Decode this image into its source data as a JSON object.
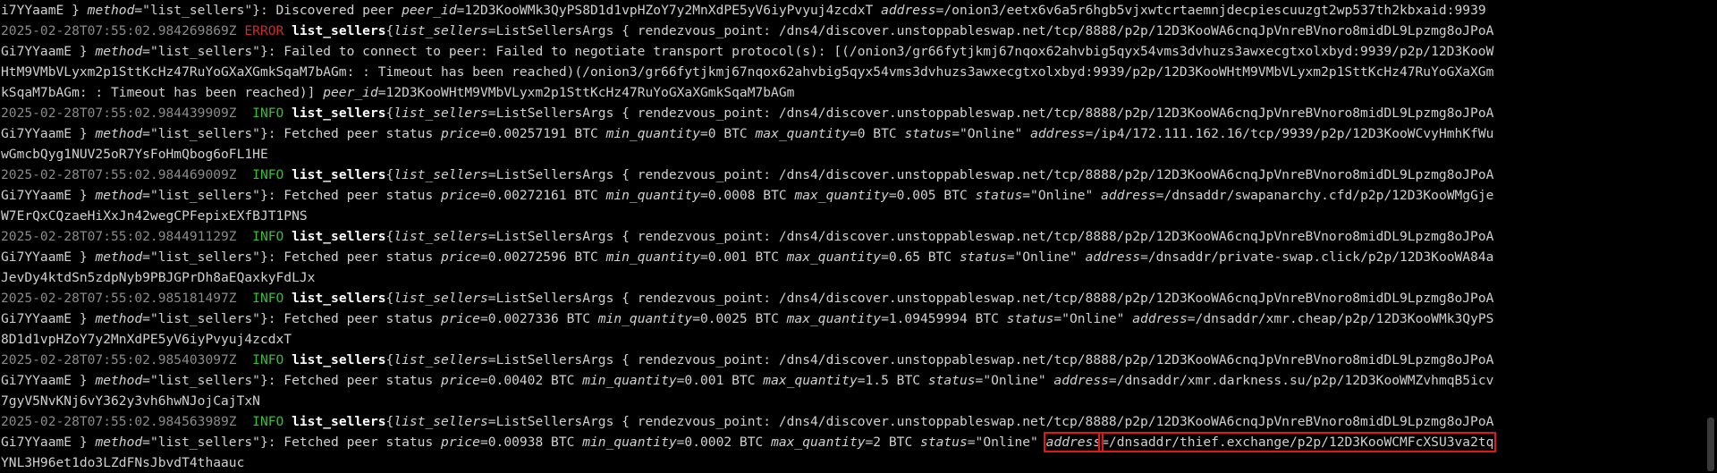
{
  "terminal": {
    "highlight_color": "#e01818",
    "level_colors": {
      "ERROR": "#cd2b2b",
      "INFO": "#3fb83f"
    },
    "lines": [
      {
        "segments": [
          {
            "t": "i7YYaamE } "
          },
          {
            "t": "method",
            "c": "key"
          },
          {
            "t": "=\"list_sellers\"}: Discovered peer "
          },
          {
            "t": "peer_id",
            "c": "key"
          },
          {
            "t": "=12D3KooWMk3QyPS8D1d1vpHZoY7y2MnXdPE5yV6iyPvyuj4zcdxT "
          },
          {
            "t": "address",
            "c": "key"
          },
          {
            "t": "=/onion3/eetx6v6a5r6hgb5vjxwtcrtaemnjdecpiescuuzgt2wp537th2kbxaid:9939"
          }
        ]
      },
      {
        "segments": [
          {
            "t": "2025-02-28T07:55:02.984269869Z ",
            "c": "ts"
          },
          {
            "t": "ERROR",
            "c": "lvl-ERROR"
          },
          {
            "t": " "
          },
          {
            "t": "list_sellers",
            "c": "span-name"
          },
          {
            "t": "{"
          },
          {
            "t": "list_sellers",
            "c": "key"
          },
          {
            "t": "=ListSellersArgs { rendezvous_point: /dns4/discover.unstoppableswap.net/tcp/8888/p2p/12D3KooWA6cnqJpVnreBVnoro8midDL9Lpzmg8oJPoA"
          }
        ]
      },
      {
        "segments": [
          {
            "t": "Gi7YYaamE } "
          },
          {
            "t": "method",
            "c": "key"
          },
          {
            "t": "=\"list_sellers\"}: Failed to connect to peer: Failed to negotiate transport protocol(s): [(/onion3/gr66fytjkmj67nqox62ahvbig5qyx54vms3dvhuzs3awxecgtxolxbyd:9939/p2p/12D3KooW"
          }
        ]
      },
      {
        "segments": [
          {
            "t": "HtM9VMbVLyxm2p1SttKcHz47RuYoGXaXGmkSqaM7bAGm: : Timeout has been reached)(/onion3/gr66fytjkmj67nqox62ahvbig5qyx54vms3dvhuzs3awxecgtxolxbyd:9939/p2p/12D3KooWHtM9VMbVLyxm2p1SttKcHz47RuYoGXaXGm"
          }
        ]
      },
      {
        "segments": [
          {
            "t": "kSqaM7bAGm: : Timeout has been reached)] "
          },
          {
            "t": "peer_id",
            "c": "key"
          },
          {
            "t": "=12D3KooWHtM9VMbVLyxm2p1SttKcHz47RuYoGXaXGmkSqaM7bAGm"
          }
        ]
      },
      {
        "segments": [
          {
            "t": "2025-02-28T07:55:02.984439909Z ",
            "c": "ts"
          },
          {
            "t": " INFO",
            "c": "lvl-INFO"
          },
          {
            "t": " "
          },
          {
            "t": "list_sellers",
            "c": "span-name"
          },
          {
            "t": "{"
          },
          {
            "t": "list_sellers",
            "c": "key"
          },
          {
            "t": "=ListSellersArgs { rendezvous_point: /dns4/discover.unstoppableswap.net/tcp/8888/p2p/12D3KooWA6cnqJpVnreBVnoro8midDL9Lpzmg8oJPoA"
          }
        ]
      },
      {
        "segments": [
          {
            "t": "Gi7YYaamE } "
          },
          {
            "t": "method",
            "c": "key"
          },
          {
            "t": "=\"list_sellers\"}: Fetched peer status "
          },
          {
            "t": "price",
            "c": "key"
          },
          {
            "t": "=0.00257191 BTC "
          },
          {
            "t": "min_quantity",
            "c": "key"
          },
          {
            "t": "=0 BTC "
          },
          {
            "t": "max_quantity",
            "c": "key"
          },
          {
            "t": "=0 BTC "
          },
          {
            "t": "status",
            "c": "key"
          },
          {
            "t": "=\"Online\" "
          },
          {
            "t": "address",
            "c": "key"
          },
          {
            "t": "=/ip4/172.111.162.16/tcp/9939/p2p/12D3KooWCvyHmhKfWu"
          }
        ]
      },
      {
        "segments": [
          {
            "t": "wGmcbQyg1NUV25oR7YsFoHmQbog6oFL1HE"
          }
        ]
      },
      {
        "segments": [
          {
            "t": "2025-02-28T07:55:02.984469009Z ",
            "c": "ts"
          },
          {
            "t": " INFO",
            "c": "lvl-INFO"
          },
          {
            "t": " "
          },
          {
            "t": "list_sellers",
            "c": "span-name"
          },
          {
            "t": "{"
          },
          {
            "t": "list_sellers",
            "c": "key"
          },
          {
            "t": "=ListSellersArgs { rendezvous_point: /dns4/discover.unstoppableswap.net/tcp/8888/p2p/12D3KooWA6cnqJpVnreBVnoro8midDL9Lpzmg8oJPoA"
          }
        ]
      },
      {
        "segments": [
          {
            "t": "Gi7YYaamE } "
          },
          {
            "t": "method",
            "c": "key"
          },
          {
            "t": "=\"list_sellers\"}: Fetched peer status "
          },
          {
            "t": "price",
            "c": "key"
          },
          {
            "t": "=0.00272161 BTC "
          },
          {
            "t": "min_quantity",
            "c": "key"
          },
          {
            "t": "=0.0008 BTC "
          },
          {
            "t": "max_quantity",
            "c": "key"
          },
          {
            "t": "=0.005 BTC "
          },
          {
            "t": "status",
            "c": "key"
          },
          {
            "t": "=\"Online\" "
          },
          {
            "t": "address",
            "c": "key"
          },
          {
            "t": "=/dnsaddr/swapanarchy.cfd/p2p/12D3KooWMgGje"
          }
        ]
      },
      {
        "segments": [
          {
            "t": "W7ErQxCQzaeHiXxJn42wegCPFepixEXfBJT1PNS"
          }
        ]
      },
      {
        "segments": [
          {
            "t": "2025-02-28T07:55:02.984491129Z ",
            "c": "ts"
          },
          {
            "t": " INFO",
            "c": "lvl-INFO"
          },
          {
            "t": " "
          },
          {
            "t": "list_sellers",
            "c": "span-name"
          },
          {
            "t": "{"
          },
          {
            "t": "list_sellers",
            "c": "key"
          },
          {
            "t": "=ListSellersArgs { rendezvous_point: /dns4/discover.unstoppableswap.net/tcp/8888/p2p/12D3KooWA6cnqJpVnreBVnoro8midDL9Lpzmg8oJPoA"
          }
        ]
      },
      {
        "segments": [
          {
            "t": "Gi7YYaamE } "
          },
          {
            "t": "method",
            "c": "key"
          },
          {
            "t": "=\"list_sellers\"}: Fetched peer status "
          },
          {
            "t": "price",
            "c": "key"
          },
          {
            "t": "=0.00272596 BTC "
          },
          {
            "t": "min_quantity",
            "c": "key"
          },
          {
            "t": "=0.001 BTC "
          },
          {
            "t": "max_quantity",
            "c": "key"
          },
          {
            "t": "=0.65 BTC "
          },
          {
            "t": "status",
            "c": "key"
          },
          {
            "t": "=\"Online\" "
          },
          {
            "t": "address",
            "c": "key"
          },
          {
            "t": "=/dnsaddr/private-swap.click/p2p/12D3KooWA84a"
          }
        ]
      },
      {
        "segments": [
          {
            "t": "JevDy4ktdSn5zdpNyb9PBJGPrDh8aEQaxkyFdLJx"
          }
        ]
      },
      {
        "segments": [
          {
            "t": "2025-02-28T07:55:02.985181497Z ",
            "c": "ts"
          },
          {
            "t": " INFO",
            "c": "lvl-INFO"
          },
          {
            "t": " "
          },
          {
            "t": "list_sellers",
            "c": "span-name"
          },
          {
            "t": "{"
          },
          {
            "t": "list_sellers",
            "c": "key"
          },
          {
            "t": "=ListSellersArgs { rendezvous_point: /dns4/discover.unstoppableswap.net/tcp/8888/p2p/12D3KooWA6cnqJpVnreBVnoro8midDL9Lpzmg8oJPoA"
          }
        ]
      },
      {
        "segments": [
          {
            "t": "Gi7YYaamE } "
          },
          {
            "t": "method",
            "c": "key"
          },
          {
            "t": "=\"list_sellers\"}: Fetched peer status "
          },
          {
            "t": "price",
            "c": "key"
          },
          {
            "t": "=0.0027336 BTC "
          },
          {
            "t": "min_quantity",
            "c": "key"
          },
          {
            "t": "=0.0025 BTC "
          },
          {
            "t": "max_quantity",
            "c": "key"
          },
          {
            "t": "=1.09459994 BTC "
          },
          {
            "t": "status",
            "c": "key"
          },
          {
            "t": "=\"Online\" "
          },
          {
            "t": "address",
            "c": "key"
          },
          {
            "t": "=/dnsaddr/xmr.cheap/p2p/12D3KooWMk3QyPS"
          }
        ]
      },
      {
        "segments": [
          {
            "t": "8D1d1vpHZoY7y2MnXdPE5yV6iyPvyuj4zcdxT"
          }
        ]
      },
      {
        "segments": [
          {
            "t": "2025-02-28T07:55:02.985403097Z ",
            "c": "ts"
          },
          {
            "t": " INFO",
            "c": "lvl-INFO"
          },
          {
            "t": " "
          },
          {
            "t": "list_sellers",
            "c": "span-name"
          },
          {
            "t": "{"
          },
          {
            "t": "list_sellers",
            "c": "key"
          },
          {
            "t": "=ListSellersArgs { rendezvous_point: /dns4/discover.unstoppableswap.net/tcp/8888/p2p/12D3KooWA6cnqJpVnreBVnoro8midDL9Lpzmg8oJPoA"
          }
        ]
      },
      {
        "segments": [
          {
            "t": "Gi7YYaamE } "
          },
          {
            "t": "method",
            "c": "key"
          },
          {
            "t": "=\"list_sellers\"}: Fetched peer status "
          },
          {
            "t": "price",
            "c": "key"
          },
          {
            "t": "=0.00402 BTC "
          },
          {
            "t": "min_quantity",
            "c": "key"
          },
          {
            "t": "=0.001 BTC "
          },
          {
            "t": "max_quantity",
            "c": "key"
          },
          {
            "t": "=1.5 BTC "
          },
          {
            "t": "status",
            "c": "key"
          },
          {
            "t": "=\"Online\" "
          },
          {
            "t": "address",
            "c": "key"
          },
          {
            "t": "=/dnsaddr/xmr.darkness.su/p2p/12D3KooWMZvhmqB5icv"
          }
        ]
      },
      {
        "segments": [
          {
            "t": "7gyV5NvKNj6vY362y3vh6hwNJojCajTxN"
          }
        ]
      },
      {
        "segments": [
          {
            "t": "2025-02-28T07:55:02.984563989Z ",
            "c": "ts"
          },
          {
            "t": " INFO",
            "c": "lvl-INFO"
          },
          {
            "t": " "
          },
          {
            "t": "list_sellers",
            "c": "span-name"
          },
          {
            "t": "{"
          },
          {
            "t": "list_sellers",
            "c": "key"
          },
          {
            "t": "=ListSellersArgs { rendezvous_point: /dns4/discover.unstoppableswap.net/tcp/8888/p2p/12D3KooWA6cnqJpVnreBVnoro8midDL9Lpzmg8oJPoA"
          }
        ]
      },
      {
        "segments": [
          {
            "t": "Gi7YYaamE } "
          },
          {
            "t": "method",
            "c": "key"
          },
          {
            "t": "=\"list_sellers\"}: Fetched peer status "
          },
          {
            "t": "price",
            "c": "key"
          },
          {
            "t": "=0.00938 BTC "
          },
          {
            "t": "min_quantity",
            "c": "key"
          },
          {
            "t": "=0.0002 BTC "
          },
          {
            "t": "max_quantity",
            "c": "key"
          },
          {
            "t": "=2 BTC "
          },
          {
            "t": "status",
            "c": "key"
          },
          {
            "t": "=\"Online\" "
          },
          {
            "t": "address",
            "c": "key hl"
          },
          {
            "t": "=/dnsaddr/thief.exchange/p2p/12D3KooWCMFcXSU3va2tq",
            "c": "hl"
          }
        ]
      },
      {
        "segments": [
          {
            "t": "YNL3H96et1do3LZdFNsJbvdT4thaauc"
          }
        ]
      }
    ]
  }
}
